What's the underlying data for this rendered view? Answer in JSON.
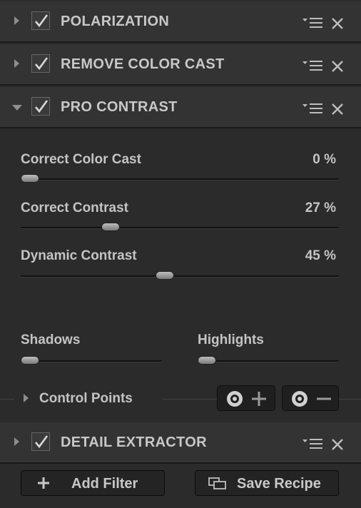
{
  "filters": [
    {
      "title": "POLARIZATION",
      "checked": true,
      "expanded": false
    },
    {
      "title": "REMOVE COLOR CAST",
      "checked": true,
      "expanded": false
    },
    {
      "title": "PRO CONTRAST",
      "checked": true,
      "expanded": true
    },
    {
      "title": "DETAIL EXTRACTOR",
      "checked": true,
      "expanded": false
    }
  ],
  "pro_contrast": {
    "sliders": [
      {
        "label": "Correct Color Cast",
        "value_text": "0 %",
        "value": 0
      },
      {
        "label": "Correct Contrast",
        "value_text": "27 %",
        "value": 27
      },
      {
        "label": "Dynamic Contrast",
        "value_text": "45 %",
        "value": 45
      }
    ],
    "shadows": {
      "label": "Shadows",
      "value": 0
    },
    "highlights": {
      "label": "Highlights",
      "value": 0
    },
    "control_points": {
      "label": "Control Points"
    }
  },
  "footer": {
    "add_filter": "Add Filter",
    "save_recipe": "Save Recipe"
  },
  "icons": {
    "expand": "triangle-right-icon",
    "collapse": "triangle-down-icon",
    "check": "checkmark-icon",
    "menu": "menu-dropdown-icon",
    "close": "close-icon",
    "add_cp": "add-control-point-icon",
    "remove_cp": "remove-control-point-icon",
    "plus": "plus-icon",
    "save": "save-recipe-icon"
  },
  "colors": {
    "header_bg": "#333333",
    "panel_bg": "#2b2b2b",
    "text": "#c8c8c8"
  }
}
